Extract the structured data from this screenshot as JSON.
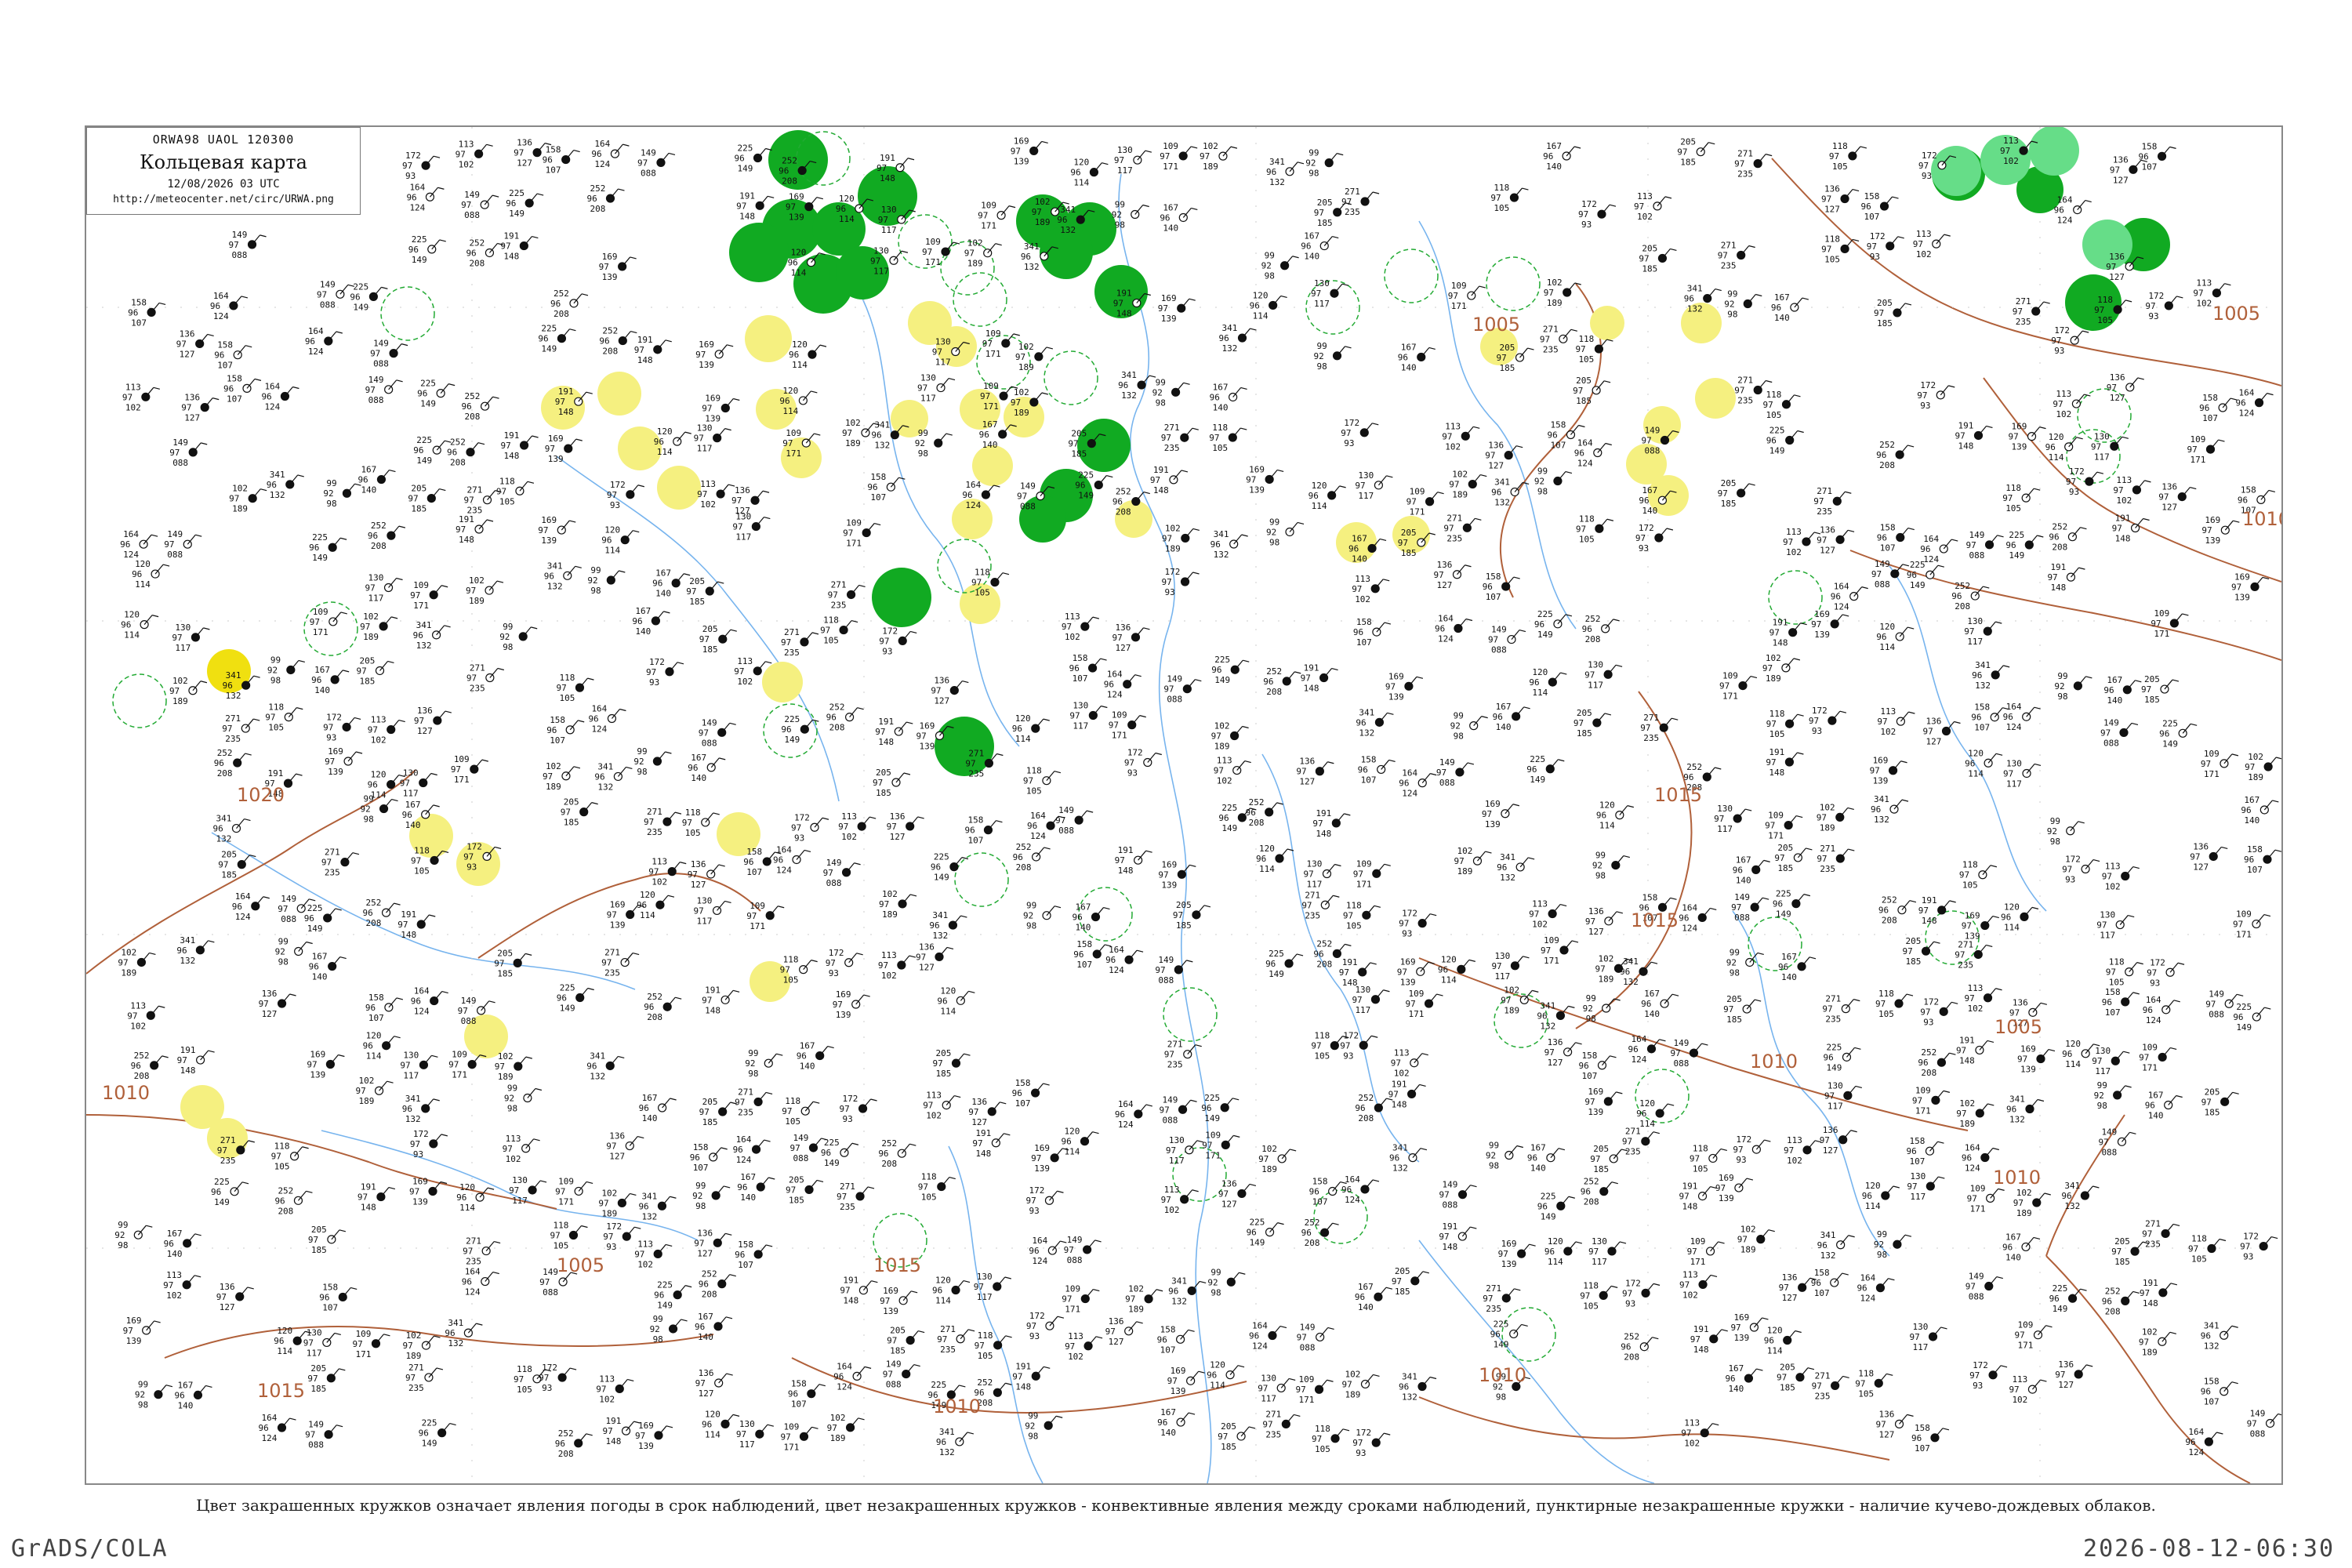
{
  "title_box": {
    "header": "ОRWA98  UAOL  120300",
    "title": "Кольцевая карта",
    "datetime": "12/08/2026 03 UTC",
    "url": "http://meteocenter.net/circ/URWA.png"
  },
  "caption": "Цвет закрашенных кружков означает явления погоды в срок наблюдений, цвет незакрашенных кружков - конвективные явления между сроками наблюдений, пунктирные незакрашенные кружки - наличие кучево-дождевых облаков.",
  "footer": {
    "left": "GrADS/COLA",
    "right": "2026-08-12-06:30"
  },
  "colors": {
    "isobar": "#b0603a",
    "rivers": "#66aaee",
    "thunderstorm": "#11aa22",
    "thunderstorm_light": "#66dd88",
    "fog_haze": "#f5f080",
    "yellow_strong": "#f0e010",
    "cb_circle": "#22aa33"
  },
  "isobar_labels": [
    "1005",
    "1010",
    "1015",
    "1020",
    "1005",
    "1010",
    "1015",
    "1010",
    "1005",
    "1010",
    "1015",
    "1010",
    "1010",
    "1015",
    "1005",
    "1010"
  ],
  "map_labels": [
    {
      "text": "1005",
      "kind": "isobar"
    },
    {
      "text": "1010",
      "kind": "isobar"
    },
    {
      "text": "1015",
      "kind": "isobar"
    },
    {
      "text": "1020",
      "kind": "isobar"
    }
  ],
  "station_samples": [
    {
      "line1": "172",
      "line2": "97",
      "line3": "93"
    },
    {
      "line1": "113",
      "line2": "97",
      "line3": "102"
    },
    {
      "line1": "136",
      "line2": "97",
      "line3": "127"
    },
    {
      "line1": "158",
      "line2": "96",
      "line3": "107"
    },
    {
      "line1": "164",
      "line2": "96",
      "line3": "124"
    },
    {
      "line1": "149",
      "line2": "97",
      "line3": "088"
    },
    {
      "line1": "225",
      "line2": "96",
      "line3": "149"
    },
    {
      "line1": "252",
      "line2": "96",
      "line3": "208"
    },
    {
      "line1": "191",
      "line2": "97",
      "line3": "148"
    },
    {
      "line1": "169",
      "line2": "97",
      "line3": "139"
    },
    {
      "line1": "120",
      "line2": "96",
      "line3": "114"
    },
    {
      "line1": "130",
      "line2": "97",
      "line3": "117"
    },
    {
      "line1": "109",
      "line2": "97",
      "line3": "171"
    },
    {
      "line1": "102",
      "line2": "97",
      "line3": "189"
    },
    {
      "line1": "341",
      "line2": "96",
      "line3": "132"
    },
    {
      "line1": "99",
      "line2": "92",
      "line3": "98"
    },
    {
      "line1": "167",
      "line2": "96",
      "line3": "140"
    },
    {
      "line1": "205",
      "line2": "97",
      "line3": "185"
    },
    {
      "line1": "271",
      "line2": "97",
      "line3": "235"
    },
    {
      "line1": "118",
      "line2": "97",
      "line3": "105"
    }
  ]
}
